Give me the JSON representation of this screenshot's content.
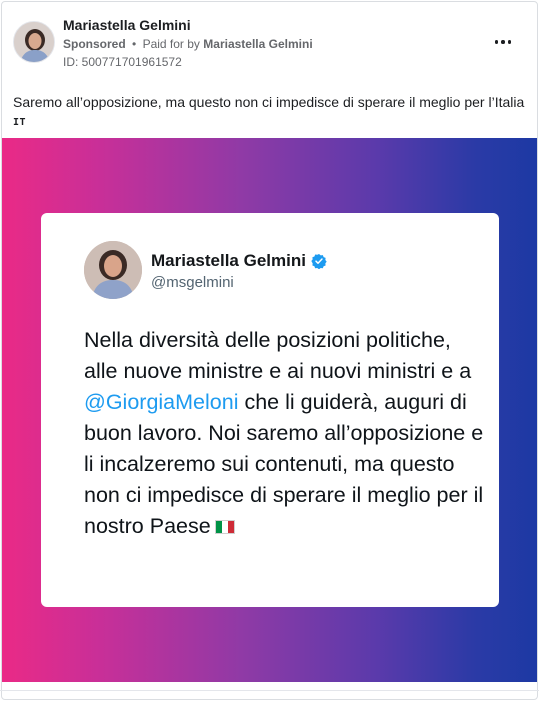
{
  "ad": {
    "page_name": "Mariastella Gelmini",
    "sponsored_label": "Sponsored",
    "separator": "•",
    "paid_for_prefix": "Paid for by",
    "paid_for_name": "Mariastella Gelmini",
    "library_id": "ID: 500771701961572",
    "caption": "Saremo all’opposizione, ma questo non ci impedisce di sperare il meglio per l’Italia",
    "language_tag": "IT",
    "more_icon": "more-horizontal-icon"
  },
  "creative": {
    "gradient_colors": [
      "#ea2a86",
      "#8f3aa6",
      "#1c39a4"
    ],
    "tweet": {
      "author_name": "Mariastella Gelmini",
      "handle": "@msgelmini",
      "verified_icon": "verified-badge-icon",
      "verified_color": "#1d9bf0",
      "text_before_mention": "Nella diversità delle posizioni politiche, alle nuove ministre e ai nuovi ministri e a ",
      "mention": "@GiorgiaMeloni",
      "text_after_mention": " che li guiderà, auguri di buon lavoro. Noi saremo all’opposizione e li incalzeremo sui contenuti, ma questo non ci impedisce di sperare il meglio per il nostro Paese",
      "flag_icon": "italy-flag-icon"
    }
  }
}
